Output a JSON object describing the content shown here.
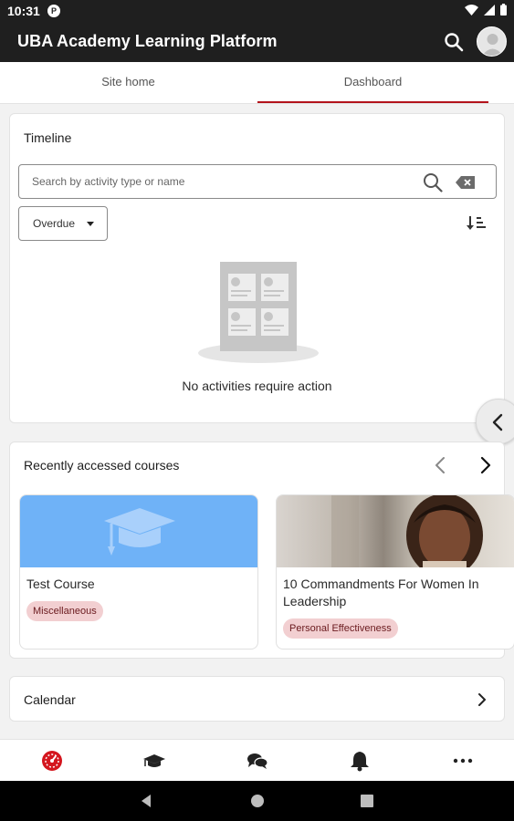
{
  "status_bar": {
    "time": "10:31",
    "app_badge": "P"
  },
  "app_bar": {
    "title": "UBA Academy Learning Platform"
  },
  "tabs": [
    {
      "label": "Site home",
      "active": false
    },
    {
      "label": "Dashboard",
      "active": true
    }
  ],
  "timeline": {
    "title": "Timeline",
    "search_placeholder": "Search by activity type or name",
    "filter_value": "Overdue",
    "empty_message": "No activities require action"
  },
  "recent_courses": {
    "title": "Recently accessed courses",
    "courses": [
      {
        "name": "Test Course",
        "category": "Miscellaneous"
      },
      {
        "name": "10 Commandments For Women In Leadership",
        "category": "Personal Effectiveness"
      }
    ]
  },
  "calendar": {
    "title": "Calendar"
  },
  "bottom_nav": [
    "dashboard-icon",
    "courses-icon",
    "messages-icon",
    "notifications-icon",
    "more-icon"
  ],
  "colors": {
    "accent": "#b3131b",
    "appbar": "#1f1f1f",
    "course_blue": "#6fb2f7",
    "tag_bg": "#f2cfd1"
  }
}
